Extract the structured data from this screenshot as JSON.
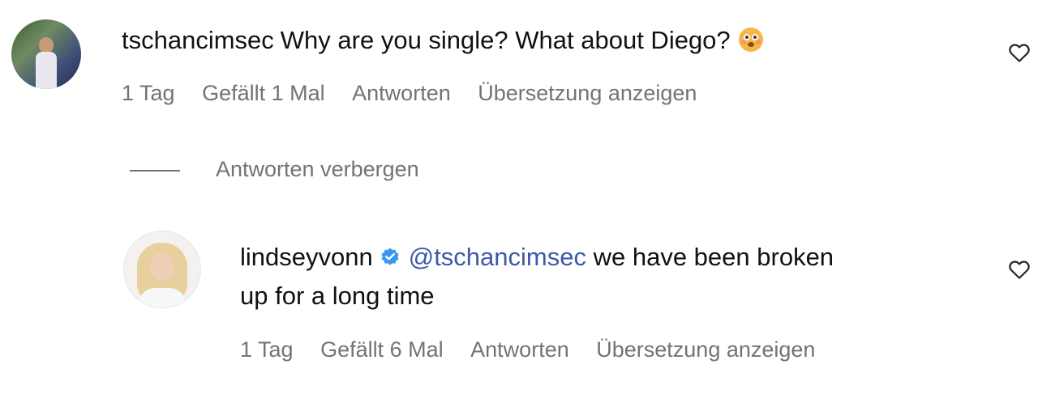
{
  "comments": [
    {
      "username": "tschancimsec",
      "text": "Why are you single? What about Diego?",
      "emoji": "flushed-face-emoji",
      "meta": {
        "time": "1 Tag",
        "likes": "Gefällt 1 Mal",
        "reply": "Antworten",
        "translate": "Übersetzung anzeigen"
      }
    }
  ],
  "hide_replies_label": "Antworten verbergen",
  "reply": {
    "username": "lindseyvonn",
    "verified": true,
    "mention": "@tschancimsec",
    "text_line1": "we have been broken",
    "text_line2": "up for a long time",
    "meta": {
      "time": "1 Tag",
      "likes": "Gefällt 6 Mal",
      "reply": "Antworten",
      "translate": "Übersetzung anzeigen"
    }
  },
  "icons": {
    "like": "heart-outline-icon",
    "verified": "verified-badge-icon"
  },
  "colors": {
    "mention": "#3c5aa6",
    "meta": "#737373",
    "verified": "#3897f0"
  }
}
